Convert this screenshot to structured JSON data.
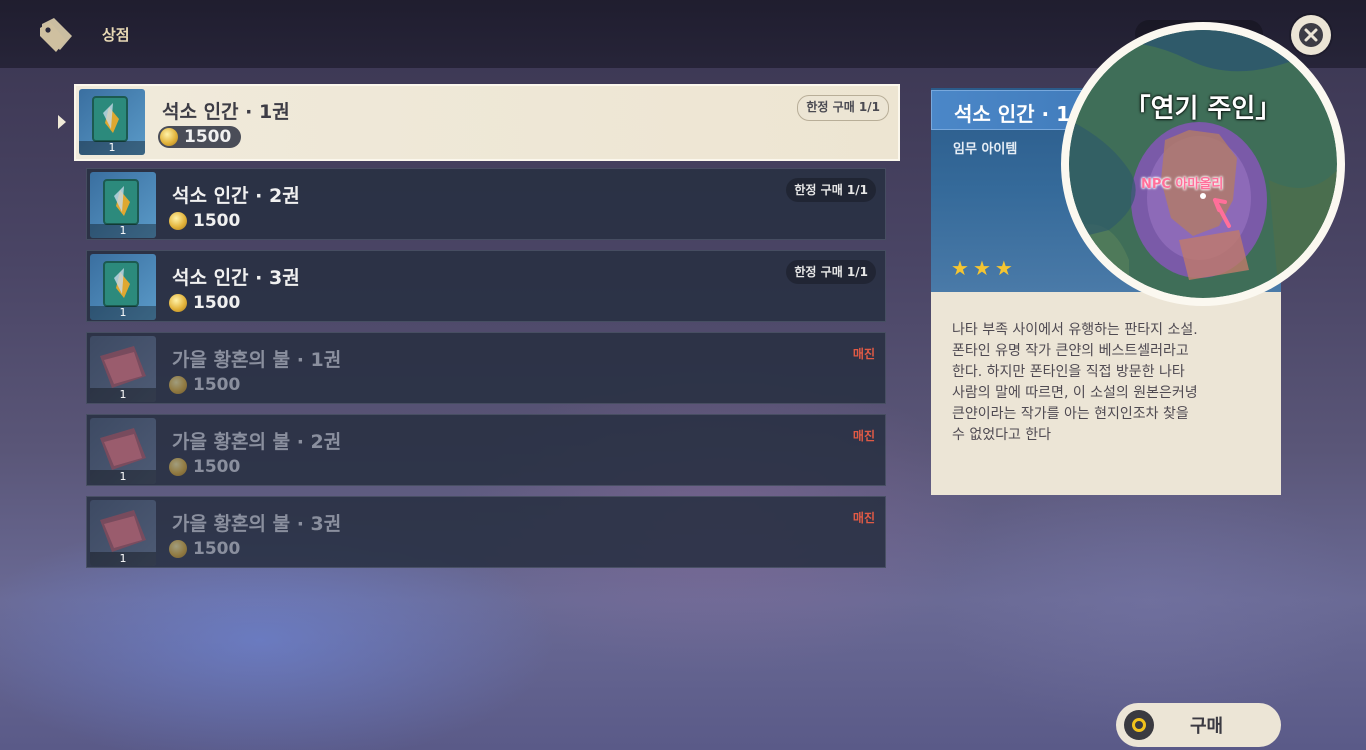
{
  "header": {
    "title": "상점",
    "icon": "tag-icon"
  },
  "items": [
    {
      "name": "석소 인간 · 1권",
      "price": "1500",
      "qty": "1",
      "limit": "한정 구매 1/1",
      "status": "",
      "selected": true
    },
    {
      "name": "석소 인간 · 2권",
      "price": "1500",
      "qty": "1",
      "limit": "한정 구매 1/1",
      "status": ""
    },
    {
      "name": "석소 인간 · 3권",
      "price": "1500",
      "qty": "1",
      "limit": "한정 구매 1/1",
      "status": ""
    },
    {
      "name": "가을 황혼의 불 · 1권",
      "price": "1500",
      "qty": "1",
      "limit": "",
      "status": "매진"
    },
    {
      "name": "가을 황혼의 불 · 2권",
      "price": "1500",
      "qty": "1",
      "limit": "",
      "status": "매진"
    },
    {
      "name": "가을 황혼의 불 · 3권",
      "price": "1500",
      "qty": "1",
      "limit": "",
      "status": "매진"
    }
  ],
  "detail": {
    "title": "석소 인간 · 1",
    "type": "임무 아이템",
    "stars": 3,
    "description": "나타 부족 사이에서 유행하는 판타지 소설.\n폰타인 유명 작가 큰얀의 베스트셀러라고\n한다. 하지만 폰타인을 직접 방문한 나타\n사람의 말에 따르면, 이 소설의 원본은커녕\n큰얀이라는 작가를 아는 현지인조차 찾을\n수 없었다고 한다"
  },
  "map_overlay": {
    "title": "「연기 주인」",
    "npc_label": "NPC 아마올리"
  },
  "buy": {
    "label": "구매"
  },
  "colors": {
    "accent_blue": "#3f79b8",
    "panel_cream": "#ece5d6",
    "soldout_red": "#e05a45",
    "star_gold": "#f5c531"
  }
}
